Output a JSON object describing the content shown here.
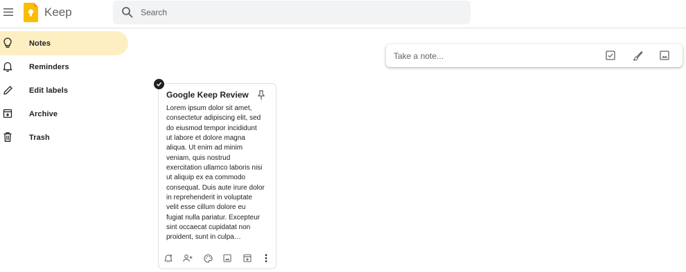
{
  "header": {
    "app_title": "Keep",
    "search": {
      "placeholder": "Search",
      "value": ""
    },
    "icons": {
      "menu": "hamburger-menu-icon",
      "logo": "keep-logo-icon",
      "search": "search-icon"
    }
  },
  "sidebar": {
    "items": [
      {
        "label": "Notes",
        "icon": "lightbulb-icon",
        "active": true
      },
      {
        "label": "Reminders",
        "icon": "bell-icon",
        "active": false
      },
      {
        "label": "Edit labels",
        "icon": "pencil-icon",
        "active": false
      },
      {
        "label": "Archive",
        "icon": "archive-icon",
        "active": false
      },
      {
        "label": "Trash",
        "icon": "trash-icon",
        "active": false
      }
    ]
  },
  "take_note": {
    "placeholder": "Take a note...",
    "value": "",
    "actions": [
      "checkbox-list-icon",
      "brush-icon",
      "image-icon"
    ]
  },
  "notes": [
    {
      "title": "Google Keep Review",
      "selected": true,
      "body": "Lorem ipsum dolor sit amet,\nconsectetur adipiscing elit, sed\ndo eiusmod tempor incididunt\nut labore et dolore magna\naliqua. Ut enim ad minim\nveniam, quis nostrud\nexercitation ullamco laboris nisi\nut aliquip ex ea commodo\nconsequat. Duis aute irure dolor\nin reprehenderit in voluptate\nvelit esse cillum dolore eu\nfugiat nulla pariatur. Excepteur\nsint occaecat cupidatat non\nproident, sunt in culpa…",
      "toolbar": [
        "remind-me-icon",
        "collaborator-icon",
        "palette-icon",
        "add-image-icon",
        "archive-icon",
        "more-vert-icon"
      ]
    }
  ],
  "colors": {
    "accent_active": "#feefc3",
    "logo_yellow": "#fbbc04",
    "search_bg": "#f1f3f4",
    "text_primary": "#202124",
    "text_secondary": "#5f6368"
  }
}
